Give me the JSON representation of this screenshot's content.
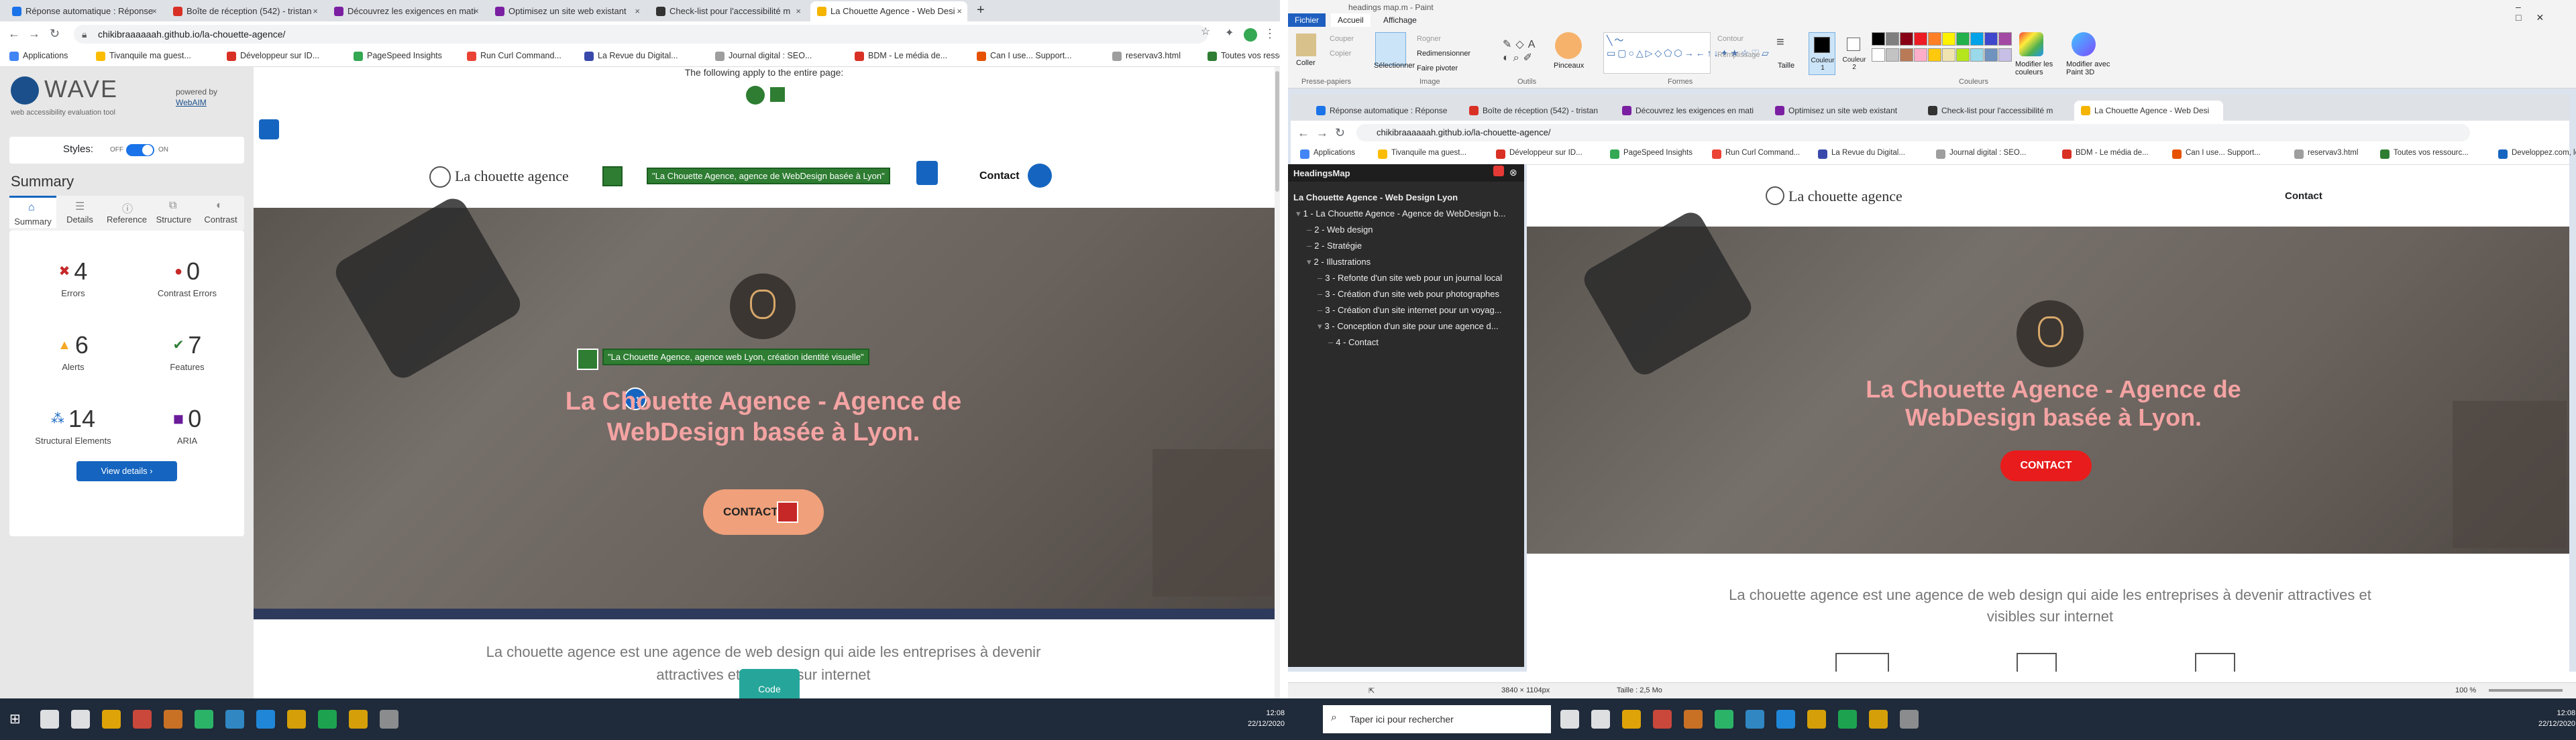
{
  "left_browser": {
    "tabs": [
      {
        "title": "Réponse automatique : Réponse",
        "color": "#1a73e8"
      },
      {
        "title": "Boîte de réception (542) - tristan",
        "color": "#d93025"
      },
      {
        "title": "Découvrez les exigences en mati",
        "color": "#7b1fa2"
      },
      {
        "title": "Optimisez un site web existant",
        "color": "#7b1fa2"
      },
      {
        "title": "Check-list pour l'accessibilité m",
        "color": "#333333"
      },
      {
        "title": "La Chouette Agence - Web Desi",
        "color": "#f4b400",
        "active": true
      }
    ],
    "url": "chikibraaaaaah.github.io/la-chouette-agence/",
    "bookmarks": [
      {
        "label": "Applications",
        "color": "#4285f4"
      },
      {
        "label": "Tivanquile ma guest...",
        "color": "#fbbc04"
      },
      {
        "label": "Développeur sur ID...",
        "color": "#d93025"
      },
      {
        "label": "PageSpeed Insights",
        "color": "#34a853"
      },
      {
        "label": "Run Curl Command...",
        "color": "#ea4335"
      },
      {
        "label": "La Revue du Digital...",
        "color": "#3949ab"
      },
      {
        "label": "Journal digital : SEO...",
        "color": "#9e9e9e"
      },
      {
        "label": "BDM - Le média de...",
        "color": "#d93025"
      },
      {
        "label": "Can I use... Support...",
        "color": "#e65100"
      },
      {
        "label": "reservav3.html",
        "color": "#9e9e9e"
      },
      {
        "label": "Toutes vos ressourc...",
        "color": "#2e7d32"
      },
      {
        "label": "Developpez.com, le...",
        "color": "#1565c0"
      }
    ]
  },
  "wave": {
    "logo": "WAVE",
    "tagline": "web accessibility evaluation tool",
    "powered_by": "powered by",
    "webaim": "WebAIM",
    "styles_label": "Styles:",
    "styles_off": "OFF",
    "styles_on": "ON",
    "summary_title": "Summary",
    "tabs": [
      "Summary",
      "Details",
      "Reference",
      "Structure",
      "Contrast"
    ],
    "stats": [
      {
        "num": "4",
        "label": "Errors",
        "color": "#c62828"
      },
      {
        "num": "0",
        "label": "Contrast Errors",
        "color": "#c62828"
      },
      {
        "num": "6",
        "label": "Alerts",
        "color": "#f9a825"
      },
      {
        "num": "7",
        "label": "Features",
        "color": "#2e7d32"
      },
      {
        "num": "14",
        "label": "Structural Elements",
        "color": "#1565c0"
      },
      {
        "num": "0",
        "label": "ARIA",
        "color": "#6a1b9a"
      }
    ],
    "view_details": "View details ›"
  },
  "page": {
    "notice": "The following apply to the entire page:",
    "logo_text": "La chouette agence",
    "header_alt": "\"La Chouette Agence, agence de WebDesign basée à Lyon\"",
    "nav_contact": "Contact",
    "owl_alt": "\"La Chouette Agence, agence web Lyon, création identité visuelle\"",
    "h1_badge": "h1",
    "hero_title": "La Chouette Agence - Agence de WebDesign basée à Lyon.",
    "cta": "CONTACT",
    "intro": "La chouette agence est une agence de web design qui aide les entreprises à devenir attractives et visibles sur internet",
    "code_toggle": "Code"
  },
  "paint": {
    "title": "headings map.m - Paint",
    "menu": [
      "Fichier",
      "Accueil",
      "Affichage"
    ],
    "groups": [
      "Presse-papiers",
      "Image",
      "Outils",
      "Formes",
      "Couleurs"
    ],
    "clipboard": [
      "Coller",
      "Couper",
      "Copier"
    ],
    "image": [
      "Sélectionner",
      "Rogner",
      "Redimensionner",
      "Faire pivoter"
    ],
    "brushes": "Pinceaux",
    "shape_opts": [
      "Contour",
      "Remplissage"
    ],
    "size": "Taille",
    "colour1": "Couleur 1",
    "colour2": "Couleur 2",
    "edit_colors": "Modifier les couleurs",
    "paint3d": "Modifier avec Paint 3D",
    "palette": [
      "#000000",
      "#7f7f7f",
      "#880015",
      "#ed1c24",
      "#ff7f27",
      "#fff200",
      "#22b14c",
      "#00a2e8",
      "#3f48cc",
      "#a349a4",
      "#ffffff",
      "#c3c3c3",
      "#b97a57",
      "#ffaec9",
      "#ffc90e",
      "#efe4b0",
      "#b5e61d",
      "#99d9ea",
      "#7092be",
      "#c8bfe7"
    ],
    "status_size": "3840 × 1104px",
    "status_file": "Taille : 2,5 Mo",
    "zoom": "100 %"
  },
  "headingsmap": {
    "title": "HeadingsMap",
    "doc_title": "La Chouette Agence - Web Design Lyon",
    "items": [
      {
        "text": "1 - La Chouette Agence - Agence de WebDesign b...",
        "level": 1
      },
      {
        "text": "2 - Web design",
        "level": 2
      },
      {
        "text": "2 - Stratégie",
        "level": 2
      },
      {
        "text": "2 - Illustrations",
        "level": 2
      },
      {
        "text": "3 - Refonte d'un site web pour un journal local",
        "level": 3
      },
      {
        "text": "3 - Création d'un site web pour photographes",
        "level": 3
      },
      {
        "text": "3 - Création d'un site internet pour un voyag...",
        "level": 3
      },
      {
        "text": "3 - Conception d'un site pour une agence d...",
        "level": 3
      },
      {
        "text": "4 - Contact",
        "level": 4
      }
    ]
  },
  "right_browser": {
    "url": "chikibraaaaaah.github.io/la-chouette-agence/",
    "logo_text": "La chouette agence",
    "nav_contact": "Contact",
    "hero_title": "La Chouette Agence - Agence de WebDesign basée à Lyon.",
    "cta": "CONTACT",
    "intro": "La chouette agence est une agence de web design qui aide les entreprises à devenir attractives et visibles sur internet"
  },
  "taskbar": {
    "search": "Taper ici pour rechercher",
    "time": "12:08",
    "date": "22/12/2020"
  }
}
